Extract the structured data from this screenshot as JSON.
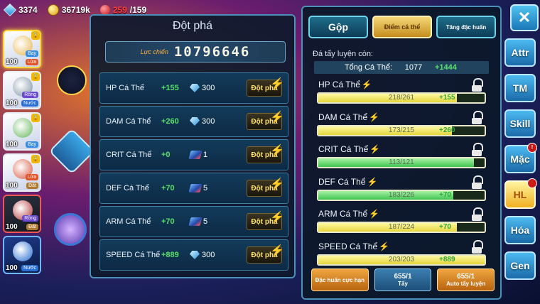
{
  "resources": {
    "gems": "3374",
    "gold": "36719k",
    "stamina_current": "259",
    "stamina_max": "/159"
  },
  "team": [
    {
      "level": "100",
      "types": [
        "Bay",
        "Lửa"
      ],
      "color": "#e7b54b"
    },
    {
      "level": "100",
      "types": [
        "Rồng",
        "Nước"
      ],
      "color": "#7a8fa0"
    },
    {
      "level": "100",
      "types": [
        "Bay"
      ],
      "color": "#64b55a"
    },
    {
      "level": "100",
      "types": [
        "Lửa",
        "Đất"
      ],
      "color": "#d8553a"
    },
    {
      "level": "100",
      "types": [
        "Rồng",
        "Đất"
      ],
      "color": "#b03030"
    },
    {
      "level": "100",
      "types": [
        "Nước"
      ],
      "color": "#1e66d0"
    }
  ],
  "breakthrough": {
    "title": "Đột phá",
    "power_label": "Lực chiến",
    "power_value": "10796646",
    "button_label": "Đột phá",
    "rows": [
      {
        "name": "HP Cá Thể",
        "plus": "+155",
        "cost": "300",
        "cost_icon": "diamond"
      },
      {
        "name": "DAM Cá Thể",
        "plus": "+260",
        "cost": "300",
        "cost_icon": "diamond"
      },
      {
        "name": "CRIT Cá Thể",
        "plus": "+0",
        "cost": "1",
        "cost_icon": "scroll"
      },
      {
        "name": "DEF Cá Thể",
        "plus": "+70",
        "cost": "5",
        "cost_icon": "scroll"
      },
      {
        "name": "ARM Cá Thể",
        "plus": "+70",
        "cost": "5",
        "cost_icon": "scroll"
      },
      {
        "name": "SPEED Cá Thể",
        "plus": "+889",
        "cost": "300",
        "cost_icon": "diamond"
      }
    ]
  },
  "tabs": {
    "merge": "Gộp",
    "iv": "Điểm cá thể",
    "trait": "Tăng đặc huấn"
  },
  "iv": {
    "remain_label": "Đá tẩy luyện còn:",
    "total_label": "Tổng Cá Thể:",
    "total_value": "1077",
    "total_plus": "+1444",
    "stats": [
      {
        "name": "HP Cá Thể",
        "value": "218/261",
        "gain": "+155",
        "ratio": 0.835,
        "color": "yellow"
      },
      {
        "name": "DAM Cá Thể",
        "value": "173/215",
        "gain": "+260",
        "ratio": 0.805,
        "color": "yellow"
      },
      {
        "name": "CRIT Cá Thể",
        "value": "113/121",
        "gain": "",
        "ratio": 0.934,
        "color": "green"
      },
      {
        "name": "DEF Cá Thể",
        "value": "183/226",
        "gain": "+70",
        "ratio": 0.81,
        "color": "green"
      },
      {
        "name": "ARM Cá Thể",
        "value": "187/224",
        "gain": "+70",
        "ratio": 0.835,
        "color": "yellow"
      },
      {
        "name": "SPEED Cá Thể",
        "value": "203/203",
        "gain": "+889",
        "ratio": 1.0,
        "color": "yellow"
      }
    ],
    "buttons": {
      "special": "Đặc huấn cực hạn",
      "wash_count": "655/1",
      "wash_label": "Tẩy",
      "auto_count": "655/1",
      "auto_label": "Auto tẩy luyện"
    }
  },
  "side_menu": [
    {
      "label": "Attr",
      "badge": ""
    },
    {
      "label": "TM",
      "badge": ""
    },
    {
      "label": "Skill",
      "badge": ""
    },
    {
      "label": "Mặc",
      "badge": "!"
    },
    {
      "label": "HL",
      "badge": "!"
    },
    {
      "label": "Hóa",
      "badge": ""
    },
    {
      "label": "Gen",
      "badge": ""
    }
  ],
  "close_icon": "close-icon"
}
